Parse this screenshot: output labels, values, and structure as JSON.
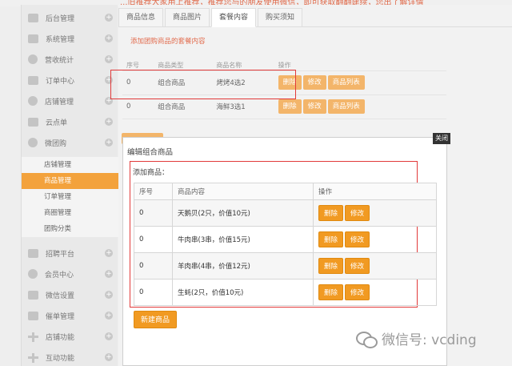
{
  "topbar": {
    "text": "...旧推荐大家用上推荐，推荐您与的朋友使用微信，即可获取翻翻建续，您出了解详情"
  },
  "sidebar": {
    "items": [
      {
        "label": "后台管理"
      },
      {
        "label": "系统管理"
      },
      {
        "label": "营收统计"
      },
      {
        "label": "订单中心"
      },
      {
        "label": "店铺管理"
      },
      {
        "label": "云点单"
      },
      {
        "label": "微团购"
      }
    ],
    "subitems": [
      {
        "label": "店铺管理"
      },
      {
        "label": "商品管理"
      },
      {
        "label": "订单管理"
      },
      {
        "label": "商圈管理"
      },
      {
        "label": "团购分类"
      }
    ],
    "items_bottom": [
      {
        "label": "招聘平台"
      },
      {
        "label": "会员中心"
      },
      {
        "label": "微信设置"
      },
      {
        "label": "催单管理"
      },
      {
        "label": "店铺功能"
      },
      {
        "label": "互动功能"
      }
    ]
  },
  "tabs": [
    {
      "label": "商品信息"
    },
    {
      "label": "商品图片"
    },
    {
      "label": "套餐内容"
    },
    {
      "label": "购买须知"
    }
  ],
  "add_link": "添加团购商品的套餐内容",
  "bg_table": {
    "headers": [
      "序号",
      "商品类型",
      "商品名称",
      "操作"
    ],
    "rows": [
      {
        "no": "0",
        "type": "组合商品",
        "name": "烤烤4选2"
      },
      {
        "no": "0",
        "type": "组合商品",
        "name": "海鲜3选1"
      }
    ],
    "btn_delete": "删除",
    "btn_edit": "修改",
    "btn_list": "商品列表"
  },
  "modal": {
    "title": "编辑组合商品",
    "close": "关闭",
    "add_label": "添加商品：",
    "headers": [
      "序号",
      "商品内容",
      "操作"
    ],
    "rows": [
      {
        "no": "0",
        "content": "天鹅贝(2只，价值10元)"
      },
      {
        "no": "0",
        "content": "牛肉串(3串，价值15元)"
      },
      {
        "no": "0",
        "content": "羊肉串(4串，价值12元)"
      },
      {
        "no": "0",
        "content": "生蚝(2只，价值10元)"
      }
    ],
    "btn_delete": "删除",
    "btn_edit": "修改",
    "new_button": "新建商品"
  },
  "watermark": {
    "text": "微信号: vcding",
    "icon": "wechat-icon"
  },
  "colors": {
    "accent": "#f19a22",
    "active_nav": "#f3a23c",
    "highlight": "#e23a3a",
    "link": "#e26c4e"
  }
}
